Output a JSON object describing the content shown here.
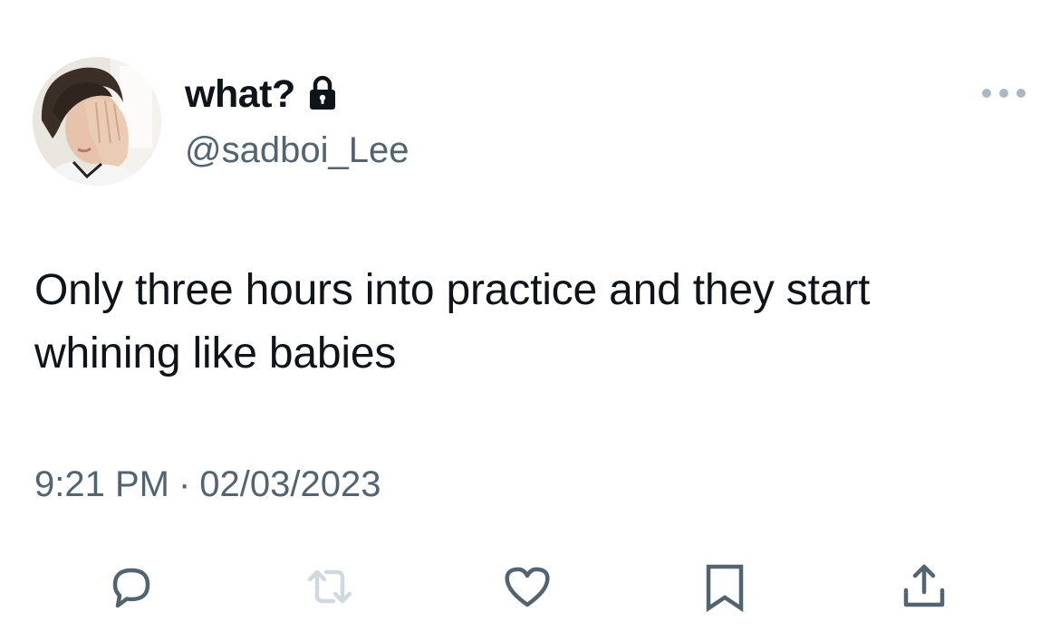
{
  "author": {
    "display_name": "what?",
    "handle": "@sadboi_Lee",
    "protected_icon": "lock-icon",
    "avatar_icon": "avatar-photo"
  },
  "tweet": {
    "text": "Only three hours into practice and they start\nwhining like babies"
  },
  "meta": {
    "time": "9:21 PM",
    "separator": "·",
    "date": "02/03/2023"
  },
  "actions": [
    {
      "name": "reply",
      "icon": "reply-icon"
    },
    {
      "name": "retweet",
      "icon": "retweet-icon"
    },
    {
      "name": "like",
      "icon": "heart-icon"
    },
    {
      "name": "bookmark",
      "icon": "bookmark-icon"
    },
    {
      "name": "share",
      "icon": "share-icon"
    }
  ],
  "colors": {
    "text_primary": "#0f1419",
    "text_secondary": "#536471",
    "icon_gray": "#536471",
    "retweet_disabled": "#cfd9de",
    "more_dots": "#aab8c2"
  }
}
